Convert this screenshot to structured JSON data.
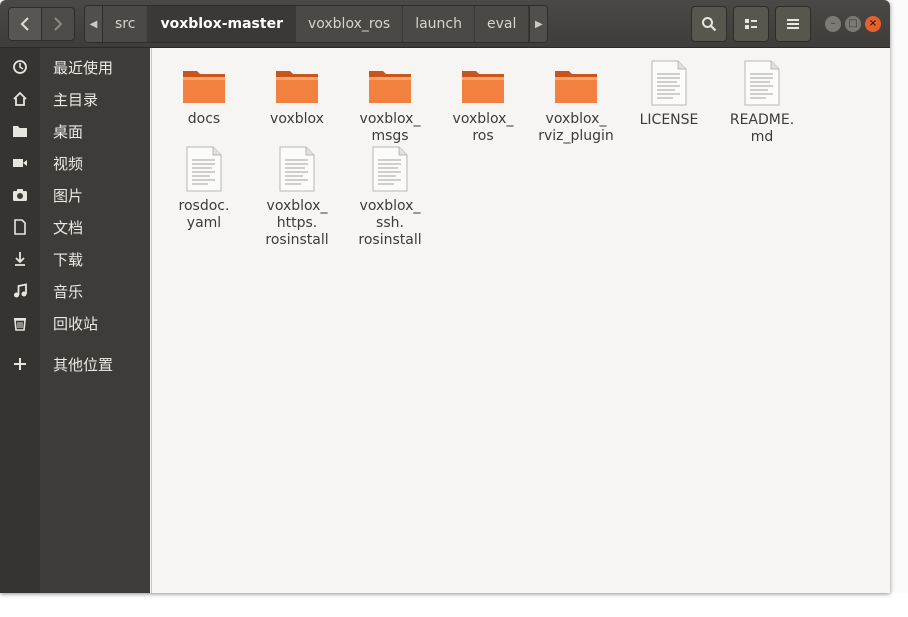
{
  "window": {
    "breadcrumbs": [
      "src",
      "voxblox-master",
      "voxblox_ros",
      "launch",
      "eval"
    ],
    "active_crumb": "voxblox-master",
    "accent_color": "#e9602f",
    "folder_color": "#f2803e"
  },
  "toolbar": {
    "back_icon": "chevron-left-icon",
    "forward_icon": "chevron-right-icon",
    "search_icon": "search-icon",
    "view_icon": "list-view-icon",
    "menu_icon": "hamburger-menu-icon"
  },
  "sidebar": {
    "items": [
      {
        "label": "最近使用",
        "icon": "clock-icon"
      },
      {
        "label": "主目录",
        "icon": "home-icon"
      },
      {
        "label": "桌面",
        "icon": "folder-icon"
      },
      {
        "label": "视频",
        "icon": "video-icon"
      },
      {
        "label": "图片",
        "icon": "camera-icon"
      },
      {
        "label": "文档",
        "icon": "document-icon"
      },
      {
        "label": "下载",
        "icon": "download-icon"
      },
      {
        "label": "音乐",
        "icon": "music-icon"
      },
      {
        "label": "回收站",
        "icon": "trash-icon"
      },
      {
        "label": "其他位置",
        "icon": "plus-icon"
      }
    ]
  },
  "files": [
    {
      "name": "docs",
      "type": "folder"
    },
    {
      "name": "voxblox",
      "type": "folder"
    },
    {
      "name": "voxblox_\nmsgs",
      "type": "folder"
    },
    {
      "name": "voxblox_\nros",
      "type": "folder"
    },
    {
      "name": "voxblox_\nrviz_plugin",
      "type": "folder"
    },
    {
      "name": "LICENSE",
      "type": "file"
    },
    {
      "name": "README.\nmd",
      "type": "file"
    },
    {
      "name": "rosdoc.\nyaml",
      "type": "file"
    },
    {
      "name": "voxblox_\nhttps.\nrosinstall",
      "type": "file"
    },
    {
      "name": "voxblox_\nssh.\nrosinstall",
      "type": "file"
    }
  ]
}
